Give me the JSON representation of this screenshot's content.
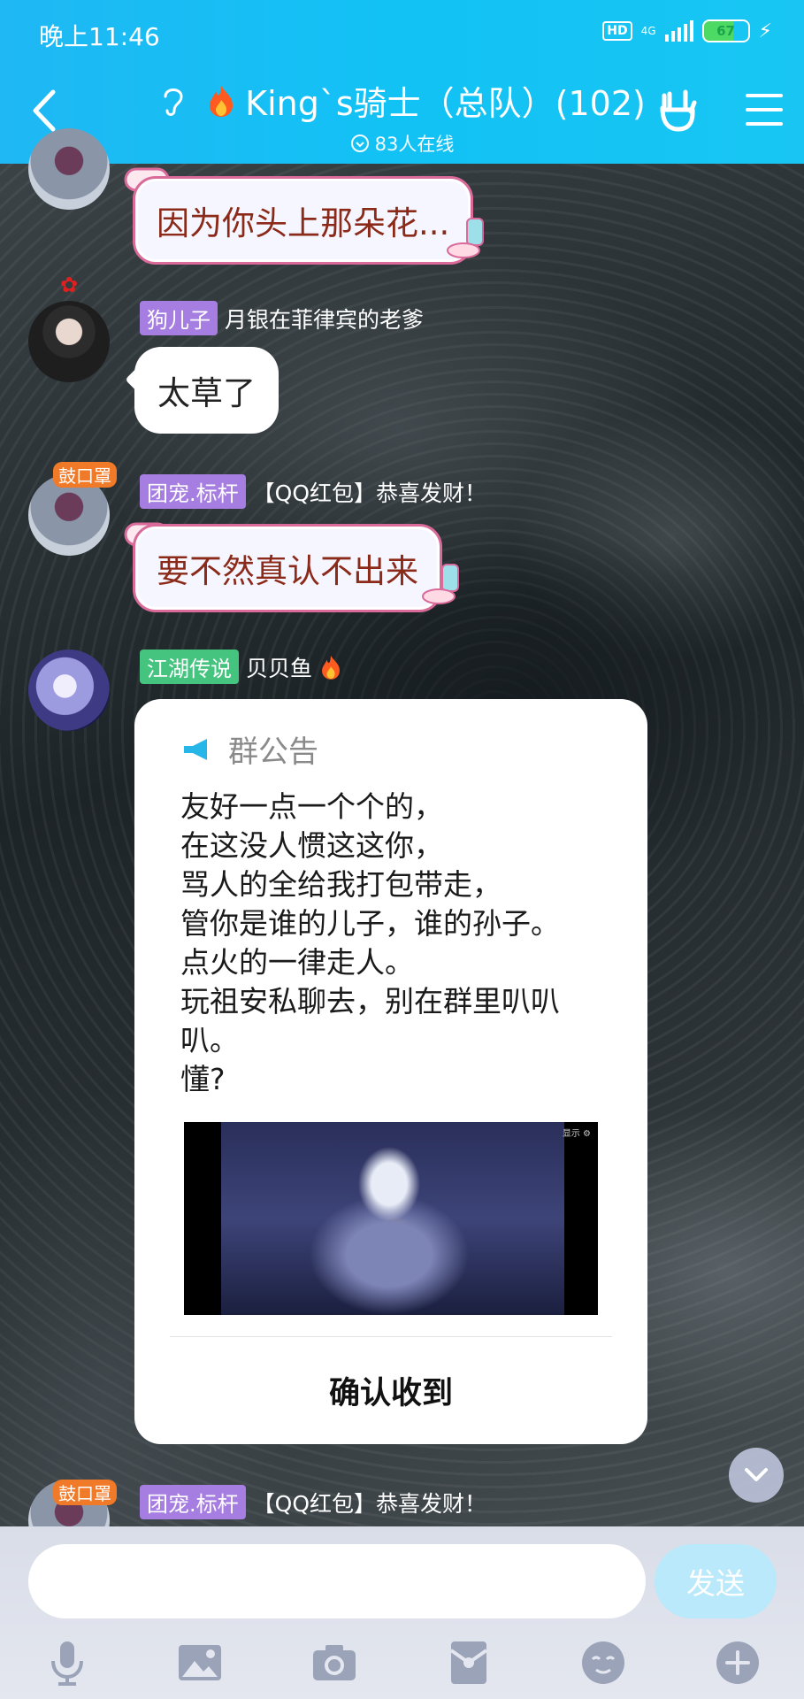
{
  "status_bar": {
    "time": "晚上11:46",
    "hd": "HD",
    "network": "4G",
    "battery": "67"
  },
  "header": {
    "title": "King`s骑士（总队）(102)",
    "online": "83人在线"
  },
  "messages": [
    {
      "text": "因为你头上那朵花..."
    },
    {
      "tag": "狗儿子",
      "name": "月银在菲律宾的老爹",
      "text": "太草了"
    },
    {
      "tag": "团宠.标杆",
      "name": "【QQ红包】恭喜发财！",
      "text": "要不然真认不出来"
    },
    {
      "tag": "江湖传说",
      "name": "贝贝鱼"
    },
    {
      "tag": "团宠.标杆",
      "name": "【QQ红包】恭喜发财！"
    }
  ],
  "badge_text": "鼓口罩",
  "notice": {
    "title": "群公告",
    "lines": [
      "友好一点一个个的，",
      "在这没人惯这这你，",
      "骂人的全给我打包带走，",
      "管你是谁的儿子，谁的孙子。",
      "点火的一律走人。",
      "玩祖安私聊去，别在群里叭叭",
      "叭。",
      "懂?"
    ],
    "image_mark": "显示 ⚙",
    "confirm": "确认收到"
  },
  "input": {
    "value": "",
    "send": "发送"
  },
  "colors": {
    "header": "#12c2f5",
    "tag_purple": "#a67de0",
    "tag_green": "#45c47f",
    "bubble_text": "#8c2a1a"
  }
}
